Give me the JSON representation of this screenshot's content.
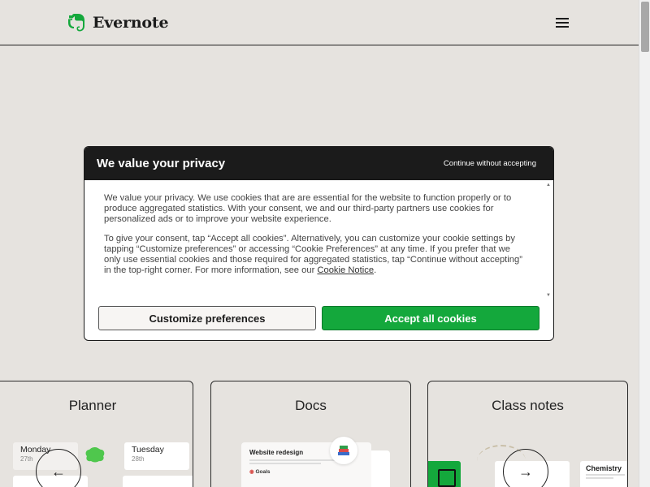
{
  "header": {
    "brand": "Evernote",
    "brand_color": "#14a83c",
    "logo_icon": "elephant-icon",
    "menu_icon": "hamburger-menu-icon"
  },
  "cookie_dialog": {
    "title": "We value your privacy",
    "continue_without_accepting": "Continue without accepting",
    "paragraph1": "We value your privacy. We use cookies that are are essential for the website to function properly or to produce aggregated statistics. With your consent, we and our third-party partners use cookies for personalized ads or to improve your website experience.",
    "paragraph2_before_link": "To give your consent, tap “Accept all cookies”. Alternatively, you can customize your cookie settings by tapping “Customize preferences” or accessing “Cookie Preferences” at any time. If you prefer that we only use essential cookies and those required for aggregated statistics, tap “Continue without accepting” in the top-right corner. For more information, see our ",
    "cookie_notice_link": "Cookie Notice",
    "paragraph2_after_link": ".",
    "customize_button": "Customize preferences",
    "accept_button": "Accept all cookies",
    "accept_color": "#14a83c"
  },
  "cards": [
    {
      "title": "Planner",
      "days": [
        {
          "day": "Monday",
          "date": "27th"
        },
        {
          "day": "Tuesday",
          "date": "28th"
        }
      ]
    },
    {
      "title": "Docs",
      "doc_title": "Website redesign",
      "doc_goals": "Goals",
      "book_icon": "books-icon"
    },
    {
      "title": "Class notes",
      "note_title": "Chemistry"
    }
  ],
  "carousel": {
    "prev_icon": "arrow-left-icon",
    "next_icon": "arrow-right-icon"
  }
}
